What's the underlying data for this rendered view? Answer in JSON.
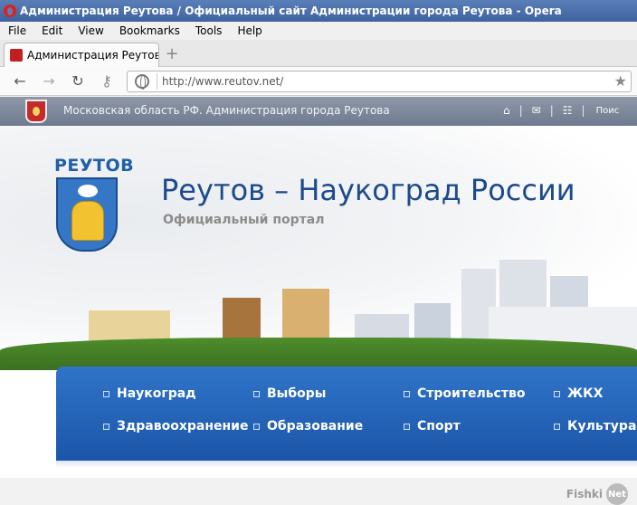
{
  "window": {
    "title": "Администрация Реутова / Официальный сайт Администрации города Реутова - Opera"
  },
  "menu": {
    "items": [
      "File",
      "Edit",
      "View",
      "Bookmarks",
      "Tools",
      "Help"
    ]
  },
  "tabs": [
    {
      "label": "Администрация Реутов..."
    }
  ],
  "toolbar": {
    "url": "http://www.reutov.net/"
  },
  "site": {
    "region_line": "Московская область РФ.  Администрация города Реутова",
    "top_icons": [
      "home-icon",
      "mail-icon",
      "sitemap-icon"
    ],
    "search_label": "Поис",
    "coat_word": "РЕУТОВ",
    "title": "Реутов – Наукоград России",
    "subtitle": "Официальный портал",
    "nav": [
      "Наукоград",
      "Выборы",
      "Строительство",
      "ЖКХ",
      "Здравоохранение",
      "Образование",
      "Спорт",
      "Культура"
    ]
  },
  "watermark": {
    "text": "Fishki",
    "badge": "Net"
  },
  "colors": {
    "titlebar": "#4a6fae",
    "site_title": "#1c4a8c",
    "nav_panel": "#1f5cae"
  }
}
